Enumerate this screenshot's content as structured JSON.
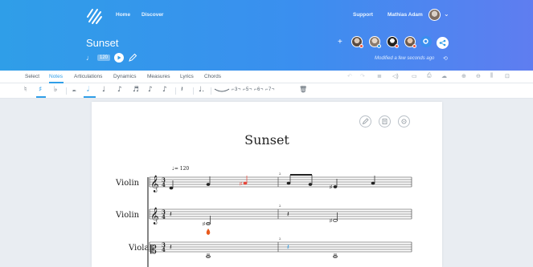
{
  "header": {
    "nav": {
      "home": "Home",
      "discover": "Discover",
      "support": "Support",
      "user": "Mathias Adam"
    },
    "score_title": "Sunset",
    "tempo": "120",
    "modified": "Modified a few seconds ago",
    "colors": {
      "accent": "#2f9ee8",
      "gradient_end": "#5f7df0"
    }
  },
  "tabs": [
    "Select",
    "Notes",
    "Articulations",
    "Dynamics",
    "Measures",
    "Lyrics",
    "Chords"
  ],
  "active_tab": "Notes",
  "toolbar": {
    "tuplets": "⌐3¬ ⌐5¬ ⌐6¬ ⌐7¬"
  },
  "sheet": {
    "title": "Sunset",
    "tempo_mark": "= 120",
    "instruments": [
      "Violin",
      "Violin",
      "Viola"
    ],
    "measure_numbers": [
      "2",
      "2",
      "2"
    ]
  }
}
